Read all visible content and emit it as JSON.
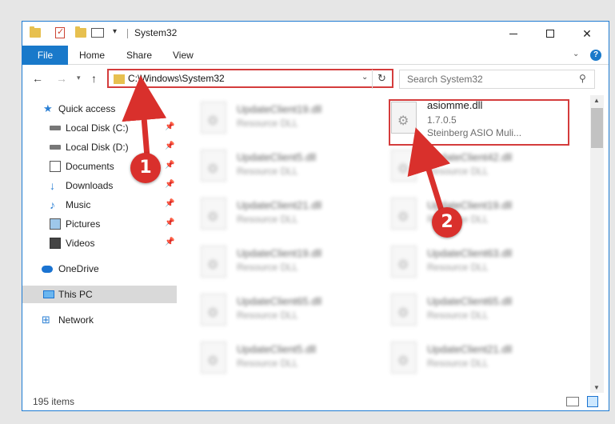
{
  "window": {
    "title": "System32"
  },
  "ribbon": {
    "tabs": [
      "File",
      "Home",
      "Share",
      "View"
    ]
  },
  "address_bar": {
    "path": "C:\\Windows\\System32"
  },
  "search": {
    "placeholder": "Search System32"
  },
  "sidebar": {
    "quick_access": "Quick access",
    "items": [
      {
        "label": "Local Disk (C:)",
        "icon": "disk-icon",
        "pinned": true
      },
      {
        "label": "Local Disk (D:)",
        "icon": "disk-icon",
        "pinned": true
      },
      {
        "label": "Documents",
        "icon": "documents-icon",
        "pinned": true
      },
      {
        "label": "Downloads",
        "icon": "download-icon",
        "pinned": true
      },
      {
        "label": "Music",
        "icon": "music-icon",
        "pinned": true
      },
      {
        "label": "Pictures",
        "icon": "pictures-icon",
        "pinned": true
      },
      {
        "label": "Videos",
        "icon": "videos-icon",
        "pinned": true
      }
    ],
    "onedrive": "OneDrive",
    "this_pc": "This PC",
    "network": "Network"
  },
  "files": {
    "left_column": [
      {
        "name": "UpdateClient19.dll",
        "type": "Resource DLL"
      },
      {
        "name": "UpdateClient5.dll",
        "type": "Resource DLL"
      },
      {
        "name": "UpdateClient21.dll",
        "type": "Resource DLL"
      },
      {
        "name": "UpdateClient19.dll",
        "type": "Resource DLL"
      },
      {
        "name": "UpdateClient65.dll",
        "type": "Resource DLL"
      },
      {
        "name": "UpdateClient5.dll",
        "type": "Resource DLL"
      }
    ],
    "highlighted": {
      "name": "asiomme.dll",
      "version": "1.7.0.5",
      "company": "Steinberg ASIO Muli..."
    },
    "right_column": [
      {
        "name": "UpdateClient42.dll",
        "type": "Resource DLL"
      },
      {
        "name": "UpdateClient19.dll",
        "type": "Resource DLL"
      },
      {
        "name": "UpdateClient63.dll",
        "type": "Resource DLL"
      },
      {
        "name": "UpdateClient65.dll",
        "type": "Resource DLL"
      },
      {
        "name": "UpdateClient21.dll",
        "type": "Resource DLL"
      }
    ]
  },
  "status": {
    "item_count": "195 items"
  },
  "annotations": {
    "badge_1": "1",
    "badge_2": "2",
    "color": "#d9302c"
  },
  "colors": {
    "accent": "#1979ca",
    "highlight_border": "#d43c3c"
  }
}
